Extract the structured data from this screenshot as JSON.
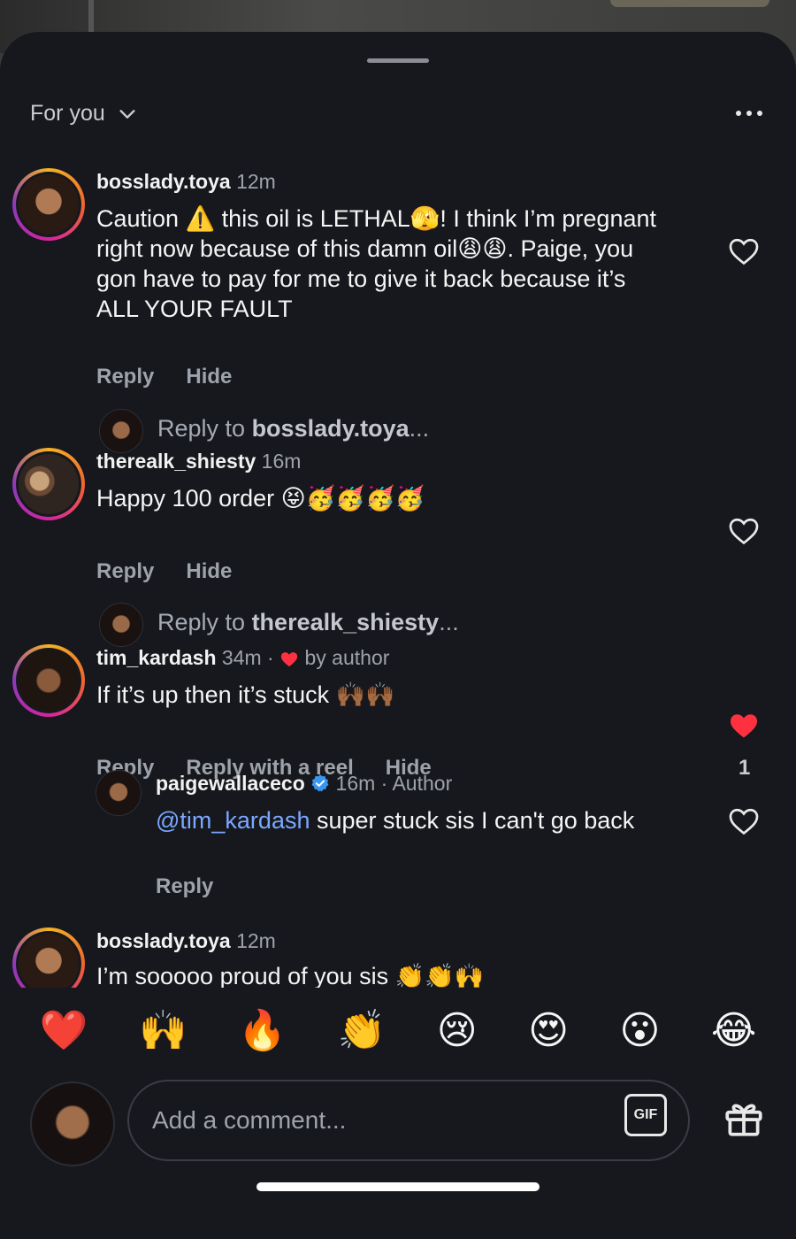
{
  "header": {
    "title": "For you"
  },
  "comments": [
    {
      "user": "bosslady.toya",
      "time": "12m",
      "text": "Caution ⚠️ this oil is LETHAL🫣! I think I’m pregnant right now because of this damn oil😩😩. Paige, you gon have to pay for me to give it back because it’s ALL YOUR FAULT",
      "actions": [
        "Reply",
        "Hide"
      ],
      "reply_prompt_prefix": "Reply to ",
      "reply_prompt_user": "bosslady.toya",
      "reply_prompt_suffix": "..."
    },
    {
      "user": "therealk_shiesty",
      "time": "16m",
      "text": "Happy 100 order 😝🥳🥳🥳🥳",
      "actions": [
        "Reply",
        "Hide"
      ],
      "reply_prompt_prefix": "Reply to ",
      "reply_prompt_user": "therealk_shiesty",
      "reply_prompt_suffix": "..."
    },
    {
      "user": "tim_kardash",
      "time": "34m",
      "sep": "·",
      "author_like": "by author",
      "text": "If it’s up then it’s stuck 🙌🏾🙌🏾",
      "actions": [
        "Reply",
        "Reply with a reel",
        "Hide"
      ],
      "like_count": "1",
      "liked": true
    }
  ],
  "author_reply": {
    "user": "paigewallaceco",
    "time": "16m",
    "sep": "·",
    "badge": "Author",
    "mention": "@tim_kardash",
    "text": " super stuck sis I can't go back",
    "action": "Reply"
  },
  "partial_comment": {
    "user": "bosslady.toya",
    "time": "12m",
    "text": "I’m sooooo proud of you sis 👏👏🙌"
  },
  "emoji_bar": [
    "❤️",
    "🙌",
    "🔥",
    "👏",
    "😢",
    "😍",
    "😮",
    "😂"
  ],
  "compose": {
    "placeholder": "Add a comment...",
    "gif_label": "GIF"
  },
  "colors": {
    "sheet_bg": "#16181d",
    "like_red": "#ff3040",
    "mention_blue": "#7aa7ff",
    "verified_blue": "#3897f0"
  }
}
